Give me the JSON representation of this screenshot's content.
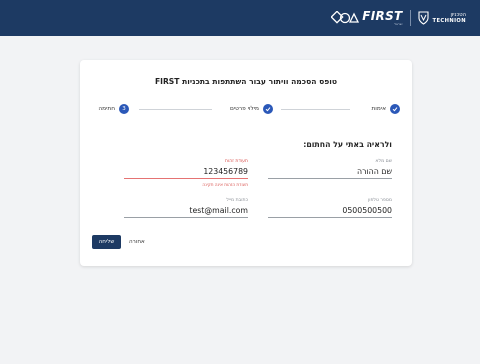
{
  "header": {
    "first_logo_text": "FIRST",
    "first_logo_subtext": "ישראל",
    "technion_he": "הטכניון",
    "technion_en": "TECHNION"
  },
  "form": {
    "title": "טופס הסכמה וויתור עבור השתתפות בתכניות FIRST",
    "steps": [
      {
        "label": "אימות",
        "state": "done"
      },
      {
        "label": "מילוי פרטים",
        "state": "done"
      },
      {
        "label": "חתימה",
        "state": "current",
        "number": "3"
      }
    ],
    "section_title": "ולראיה באתי על החתום:",
    "fields": {
      "full_name": {
        "label": "שם מלא",
        "value": "שם ההורה"
      },
      "id_number": {
        "label": "תעודת זהות",
        "value": "123456789",
        "error": "תעודת הזהות אינה תקינה"
      },
      "phone": {
        "label": "מספר טלפון",
        "value": "0500500500"
      },
      "email": {
        "label": "כתובת מייל",
        "value": "test@mail.com"
      }
    },
    "actions": {
      "submit_label": "שליחה",
      "back_label": "אחורה"
    }
  },
  "colors": {
    "header_bg": "#1d3a63",
    "step_active": "#2b58b8",
    "error": "#d9534f",
    "page_bg": "#f2f3f5"
  }
}
